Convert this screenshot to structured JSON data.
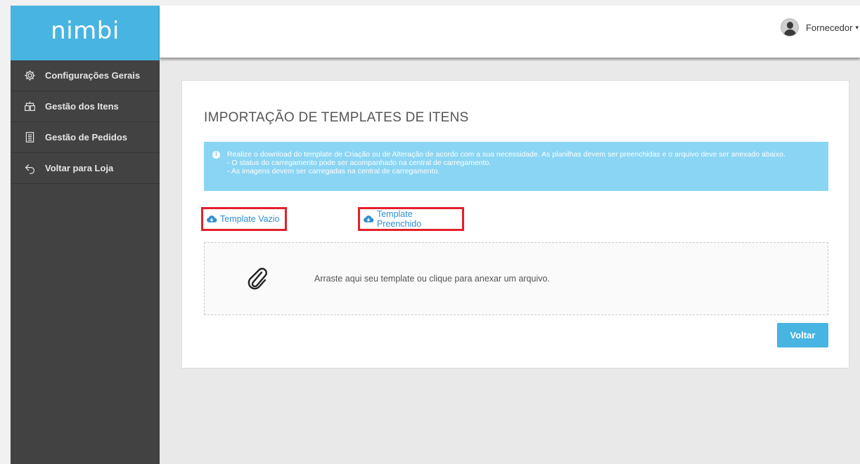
{
  "app": {
    "logo": "nimbi",
    "accent_color": "#48b4e2",
    "sidebar_color": "#424242"
  },
  "header": {
    "user_label": "Fornecedor",
    "user_menu_chevron": "▾"
  },
  "sidebar": {
    "items": [
      {
        "label": "Configurações Gerais",
        "icon": "gear-icon"
      },
      {
        "label": "Gestão dos Itens",
        "icon": "boxes-icon"
      },
      {
        "label": "Gestão de Pedidos",
        "icon": "clipboard-icon"
      },
      {
        "label": "Voltar para Loja",
        "icon": "back-arrow-icon"
      }
    ]
  },
  "main": {
    "title": "IMPORTAÇÃO DE TEMPLATES DE ITENS",
    "info": {
      "line1": "Realize o download do template de Criação ou de Alteração de acordo com a sua necessidade. As planilhas devem ser preenchidas e o arquivo deve ser anexado abaixo.",
      "line2": "- O status do carregamento pode ser acompanhado na central de carregamento.",
      "line3": "- As imagens devem ser carregadas na central de carregamento."
    },
    "template_empty_label": "Template Vazio",
    "template_filled_label": "Template Preenchido",
    "dropzone_text": "Arraste aqui seu template ou clique para anexar um arquivo.",
    "back_button": "Voltar"
  }
}
